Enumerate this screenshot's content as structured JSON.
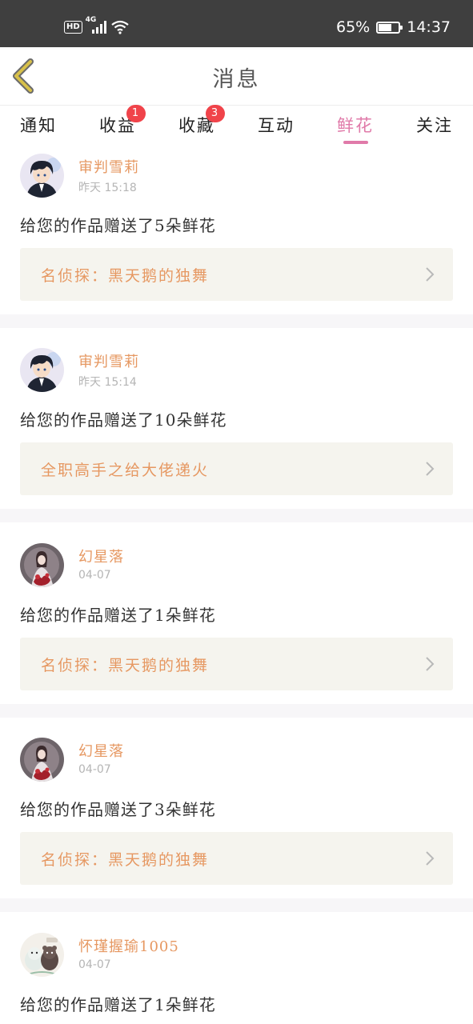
{
  "status_bar": {
    "hd": "HD",
    "network": "4G",
    "battery": "65%",
    "battery_level": 0.65,
    "time": "14:37"
  },
  "header": {
    "title": "消息"
  },
  "tabs": [
    {
      "label": "通知",
      "badge": null
    },
    {
      "label": "收益",
      "badge": "1"
    },
    {
      "label": "收藏",
      "badge": "3"
    },
    {
      "label": "互动",
      "badge": null
    },
    {
      "label": "鲜花",
      "badge": null,
      "active": true
    },
    {
      "label": "关注",
      "badge": null
    }
  ],
  "messages": [
    {
      "user": "审判雪莉",
      "time_day": "昨天",
      "time_clock": "15:18",
      "text": "给您的作品赠送了5朵鲜花",
      "work": "名侦探：黑天鹅的独舞",
      "avatar": "anime-boy-avatar"
    },
    {
      "user": "审判雪莉",
      "time_day": "昨天",
      "time_clock": "15:14",
      "text": "给您的作品赠送了10朵鲜花",
      "work": "全职高手之给大佬递火",
      "avatar": "anime-boy-avatar"
    },
    {
      "user": "幻星落",
      "time_day": "04-07",
      "time_clock": "",
      "text": "给您的作品赠送了1朵鲜花",
      "work": "名侦探：黑天鹅的独舞",
      "avatar": "red-dress-avatar"
    },
    {
      "user": "幻星落",
      "time_day": "04-07",
      "time_clock": "",
      "text": "给您的作品赠送了3朵鲜花",
      "work": "名侦探：黑天鹅的独舞",
      "avatar": "red-dress-avatar"
    },
    {
      "user": "怀瑾握瑜1005",
      "time_day": "04-07",
      "time_clock": "",
      "text": "给您的作品赠送了1朵鲜花",
      "work": "",
      "avatar": "cartoon-animals-avatar"
    }
  ],
  "colors": {
    "accent_pink": "#e07aa9",
    "accent_orange": "#e69862",
    "badge_red": "#f0434a",
    "back_arrow": "#d7c04a"
  }
}
